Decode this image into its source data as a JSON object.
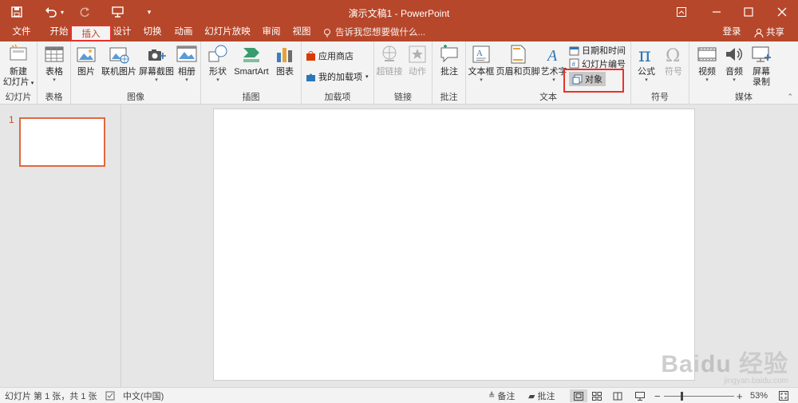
{
  "window": {
    "title": "演示文稿1 - PowerPoint"
  },
  "quick_access": {
    "save": "save-icon",
    "undo": "undo-icon",
    "redo": "redo-icon",
    "present": "present-icon",
    "customize": "▾"
  },
  "tabs": [
    "文件",
    "开始",
    "插入",
    "设计",
    "切换",
    "动画",
    "幻灯片放映",
    "审阅",
    "视图"
  ],
  "active_tab": "插入",
  "tell_me": "告诉我您想要做什么...",
  "account": {
    "login": "登录",
    "share": "共享"
  },
  "ribbon": {
    "groups": {
      "slides": "幻灯片",
      "tables": "表格",
      "images": "图像",
      "illustrations": "插图",
      "addins": "加载项",
      "links": "链接",
      "comments": "批注",
      "text": "文本",
      "symbols": "符号",
      "media": "媒体"
    },
    "buttons": {
      "new_slide_1": "新建",
      "new_slide_2": "幻灯片",
      "table": "表格",
      "picture": "图片",
      "online_picture": "联机图片",
      "screenshot": "屏幕截图",
      "album": "相册",
      "shapes": "形状",
      "smartart": "SmartArt",
      "chart": "图表",
      "store": "应用商店",
      "my_addins": "我的加载项",
      "hyperlink": "超链接",
      "action": "动作",
      "comment": "批注",
      "textbox": "文本框",
      "header_footer": "页眉和页脚",
      "wordart": "艺术字",
      "date_time": "日期和时间",
      "slide_number": "幻灯片编号",
      "object": "对象",
      "equation": "公式",
      "symbol": "符号",
      "video": "视频",
      "audio": "音频",
      "screen_rec_1": "屏幕",
      "screen_rec_2": "录制"
    }
  },
  "thumbnails": [
    {
      "number": "1"
    }
  ],
  "status": {
    "slide_info": "幻灯片 第 1 张，共 1 张",
    "language": "中文(中国)",
    "notes": "备注",
    "comments": "批注",
    "zoom": "53%",
    "zoom_level": 0.53
  },
  "colors": {
    "accent": "#b7472a",
    "highlight": "#e8312a"
  }
}
